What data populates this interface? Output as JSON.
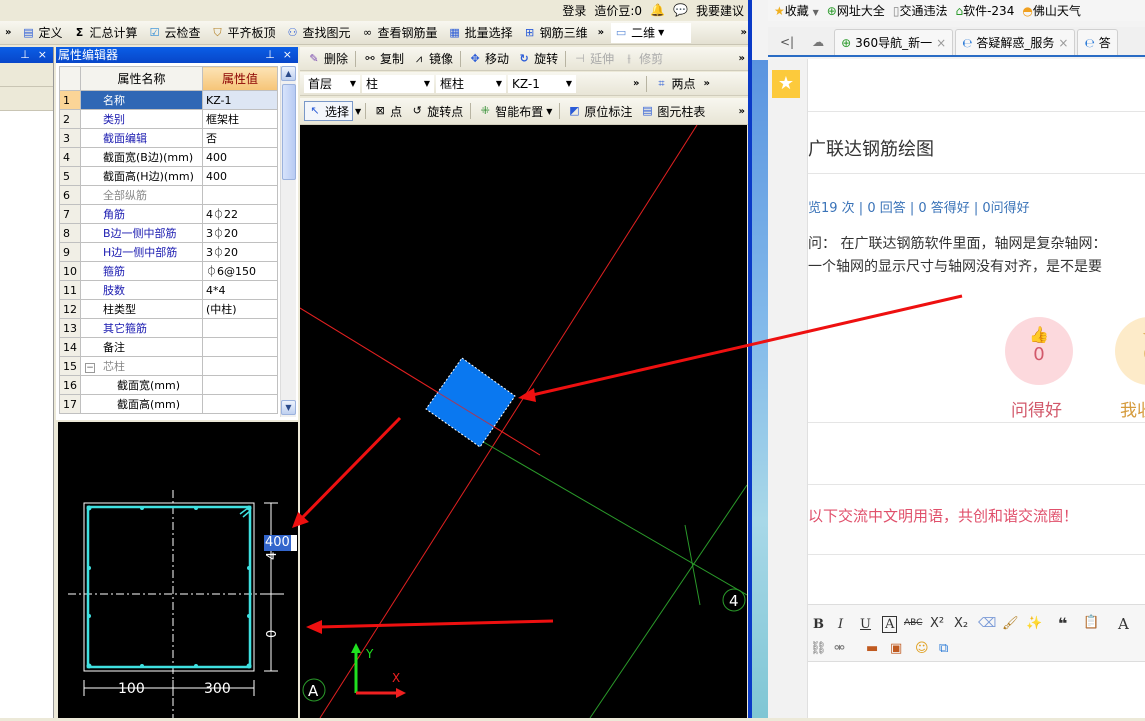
{
  "app": {
    "top_right": {
      "login": "登录",
      "beans": "造价豆:0",
      "suggest": "我要建议"
    },
    "main_toolbar": [
      "定义",
      "汇总计算",
      "云检查",
      "平齐板顶",
      "查找图元",
      "查看钢筋量",
      "批量选择",
      "钢筋三维"
    ],
    "view_mode": "二维",
    "property_editor": {
      "title": "属性编辑器",
      "col_name": "属性名称",
      "col_value": "属性值",
      "rows": [
        {
          "n": "1",
          "name": "名称",
          "value": "KZ-1",
          "style": "blue"
        },
        {
          "n": "2",
          "name": "类别",
          "value": "框架柱",
          "style": "blue"
        },
        {
          "n": "3",
          "name": "截面编辑",
          "value": "否",
          "style": "blue"
        },
        {
          "n": "4",
          "name": "截面宽(B边)(mm)",
          "value": "400",
          "style": "black"
        },
        {
          "n": "5",
          "name": "截面高(H边)(mm)",
          "value": "400",
          "style": "black"
        },
        {
          "n": "6",
          "name": "全部纵筋",
          "value": "",
          "style": "gray"
        },
        {
          "n": "7",
          "name": "角筋",
          "value": "4⏀22",
          "style": "blue"
        },
        {
          "n": "8",
          "name": "B边一侧中部筋",
          "value": "3⏀20",
          "style": "blue"
        },
        {
          "n": "9",
          "name": "H边一侧中部筋",
          "value": "3⏀20",
          "style": "blue"
        },
        {
          "n": "10",
          "name": "箍筋",
          "value": "⏀6@150",
          "style": "blue"
        },
        {
          "n": "11",
          "name": "肢数",
          "value": "4*4",
          "style": "blue"
        },
        {
          "n": "12",
          "name": "柱类型",
          "value": "(中柱)",
          "style": "black"
        },
        {
          "n": "13",
          "name": "其它箍筋",
          "value": "",
          "style": "blue"
        },
        {
          "n": "14",
          "name": "备注",
          "value": "",
          "style": "black"
        },
        {
          "n": "15",
          "name": "芯柱",
          "value": "",
          "style": "gray"
        },
        {
          "n": "16",
          "name": "截面宽(mm)",
          "value": "",
          "style": "black"
        },
        {
          "n": "17",
          "name": "截面高(mm)",
          "value": "",
          "style": "black"
        }
      ]
    },
    "edit_toolbar": [
      "删除",
      "复制",
      "镜像",
      "移动",
      "旋转",
      "延伸",
      "修剪"
    ],
    "combos": {
      "floor": "首层",
      "type": "柱",
      "subtype": "框柱",
      "name": "KZ-1"
    },
    "two_point": "两点",
    "draw_toolbar": [
      "选择",
      "点",
      "旋转点",
      "智能布置",
      "原位标注",
      "图元柱表"
    ],
    "section": {
      "dim_input": "400",
      "dim_bottom_left": "100",
      "dim_bottom_right": "300",
      "dim_side_top": "4",
      "dim_side_bottom": "0"
    },
    "cad": {
      "axis_a": "A",
      "axis_4": "4",
      "ucs_x": "X",
      "ucs_y": "Y"
    }
  },
  "browser": {
    "favorites": [
      "收藏",
      "网址大全",
      "交通违法",
      "软件-234",
      "佛山天气"
    ],
    "tabs": [
      "360导航_新一",
      "答疑解惑_服务",
      "答"
    ],
    "page": {
      "title": "广联达钢筋绘图",
      "stats": "览19 次 | 0 回答 | 0 答得好 | 0问得好",
      "body_line1": "问：  在广联达钢筋软件里面，轴网是复杂轴网：",
      "body_line2": "一个轴网的显示尺寸与轴网没有对齐，是不是要",
      "vote_good": {
        "count": "0",
        "label": "问得好"
      },
      "vote_fav": {
        "count": "0",
        "label": "我收"
      },
      "notice": "以下交流中文明用语，共创和谐交流圈！",
      "editor_buttons": [
        "B",
        "I",
        "U",
        "A",
        "ABC",
        "X²",
        "X₂",
        "A"
      ]
    }
  }
}
